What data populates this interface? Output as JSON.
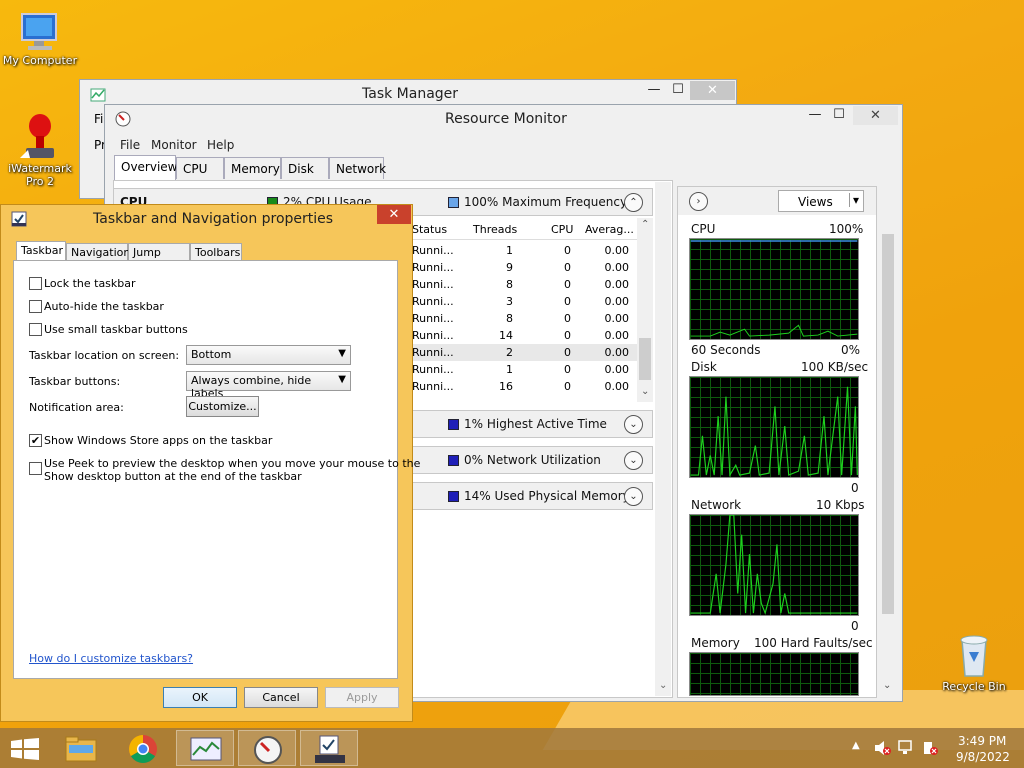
{
  "desktop": {
    "my_computer": "My Computer",
    "iwatermark_line1": "iWatermark",
    "iwatermark_line2": "Pro 2",
    "recycle_bin": "Recycle Bin"
  },
  "task_manager": {
    "title": "Task Manager",
    "menu_file_fragment": "Fil",
    "tab_fragment": "Pr"
  },
  "resource_monitor": {
    "title": "Resource Monitor",
    "menu": [
      "File",
      "Monitor",
      "Help"
    ],
    "tabs": [
      "Overview",
      "CPU",
      "Memory",
      "Disk",
      "Network"
    ],
    "cpu_section": {
      "label": "CPU",
      "usage": "2% CPU Usage",
      "frequency": "100% Maximum Frequency",
      "columns": [
        "Status",
        "Threads",
        "CPU",
        "Averag..."
      ],
      "rows": [
        {
          "status": "Runni...",
          "threads": "1",
          "cpu": "0",
          "avg": "0.00"
        },
        {
          "status": "Runni...",
          "threads": "9",
          "cpu": "0",
          "avg": "0.00"
        },
        {
          "status": "Runni...",
          "threads": "8",
          "cpu": "0",
          "avg": "0.00"
        },
        {
          "status": "Runni...",
          "threads": "3",
          "cpu": "0",
          "avg": "0.00"
        },
        {
          "status": "Runni...",
          "threads": "8",
          "cpu": "0",
          "avg": "0.00"
        },
        {
          "status": "Runni...",
          "threads": "14",
          "cpu": "0",
          "avg": "0.00"
        },
        {
          "status": "Runni...",
          "threads": "2",
          "cpu": "0",
          "avg": "0.00"
        },
        {
          "status": "Runni...",
          "threads": "1",
          "cpu": "0",
          "avg": "0.00"
        },
        {
          "status": "Runni...",
          "threads": "16",
          "cpu": "0",
          "avg": "0.00"
        }
      ]
    },
    "disk_summary": "1% Highest Active Time",
    "network_summary": "0% Network Utilization",
    "memory_summary": "14% Used Physical Memory",
    "views_label": "Views",
    "graphs": {
      "cpu": {
        "label": "CPU",
        "max": "100%",
        "footer_left": "60 Seconds",
        "footer_right": "0%"
      },
      "disk": {
        "label": "Disk",
        "max": "100 KB/sec",
        "footer_right": "0"
      },
      "network": {
        "label": "Network",
        "max": "10 Kbps",
        "footer_right": "0"
      },
      "memory": {
        "label": "Memory",
        "max": "100 Hard Faults/sec"
      }
    }
  },
  "properties_dialog": {
    "title": "Taskbar and Navigation properties",
    "tabs": [
      "Taskbar",
      "Navigation",
      "Jump Lists",
      "Toolbars"
    ],
    "lock_taskbar": "Lock the taskbar",
    "auto_hide": "Auto-hide the taskbar",
    "small_buttons": "Use small taskbar buttons",
    "location_label": "Taskbar location on screen:",
    "location_value": "Bottom",
    "buttons_label": "Taskbar buttons:",
    "buttons_value": "Always combine, hide labels",
    "notification_label": "Notification area:",
    "customize_button": "Customize...",
    "store_apps": "Show Windows Store apps on the taskbar",
    "peek_line1": "Use Peek to preview the desktop when you move your mouse to the",
    "peek_line2": "Show desktop button at the end of the taskbar",
    "help_link": "How do I customize taskbars?",
    "ok": "OK",
    "cancel": "Cancel",
    "apply": "Apply",
    "checkbox_states": {
      "lock": false,
      "autohide": false,
      "small": false,
      "store": true,
      "peek": false
    }
  },
  "taskbar": {
    "time": "3:49 PM",
    "date": "9/8/2022"
  }
}
